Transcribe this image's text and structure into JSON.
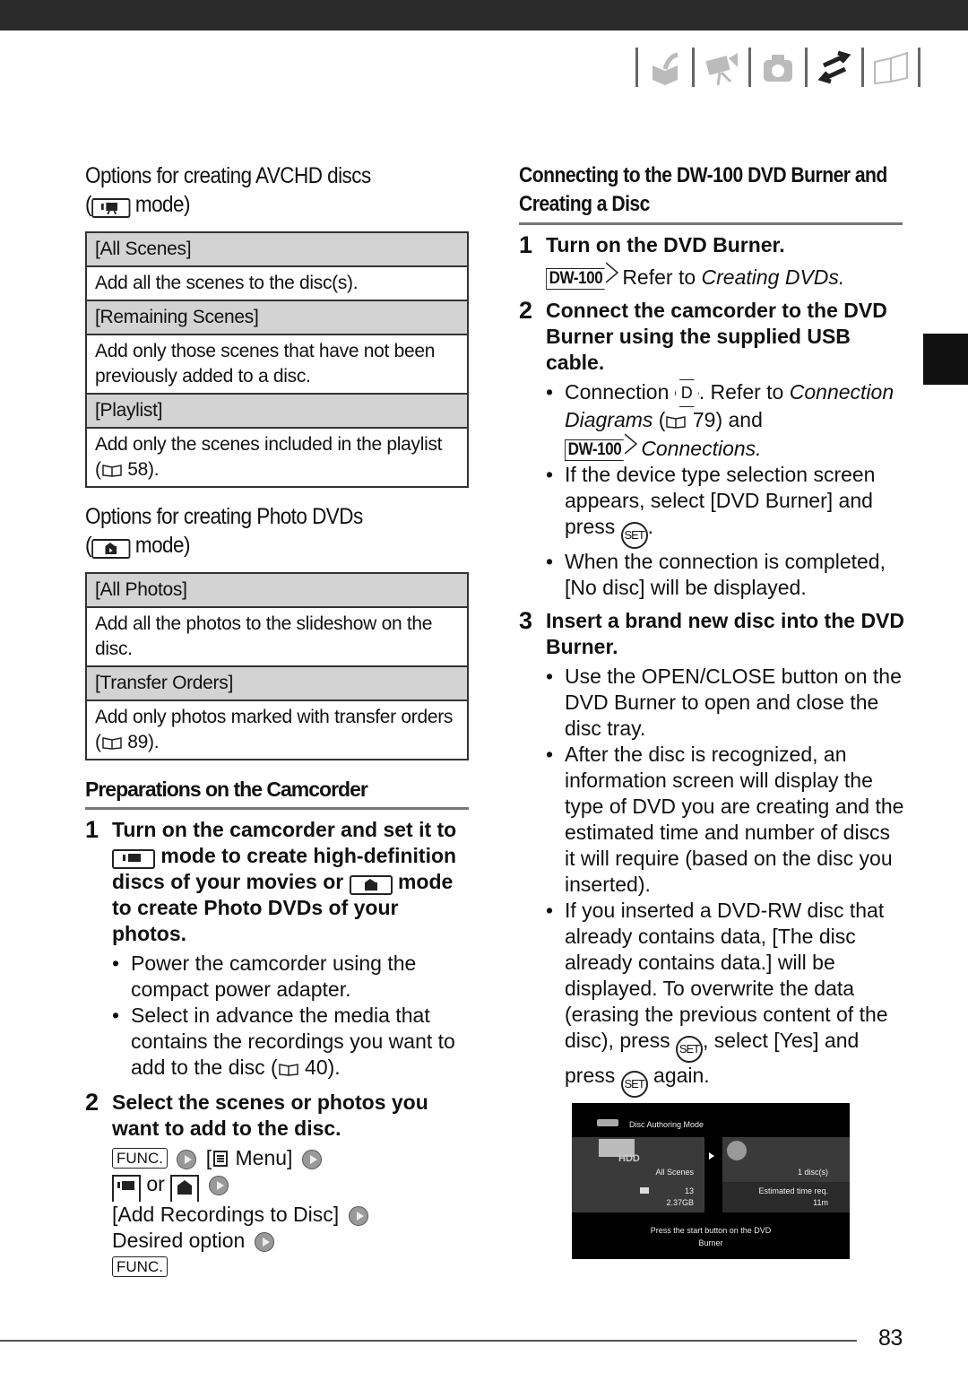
{
  "nav_icons": [
    "prepare-icon",
    "movie-icon",
    "photo-icon",
    "external-connections-icon",
    "additional-info-icon"
  ],
  "left": {
    "avchd_title_1": "Options for creating AVCHD discs",
    "avchd_title_2": "mode)",
    "avchd_rows": [
      {
        "option": "[All Scenes]",
        "desc": "Add all the scenes to the disc(s)."
      },
      {
        "option": "[Remaining Scenes]",
        "desc": "Add only those scenes that have not been previously added to a disc."
      },
      {
        "option": "[Playlist]",
        "desc": "Add only the scenes included in the playlist",
        "ref": "58)."
      }
    ],
    "photo_title_1": "Options for creating Photo DVDs",
    "photo_title_2": "mode)",
    "photo_rows": [
      {
        "option": "[All Photos]",
        "desc": "Add all the photos to the slideshow on the disc."
      },
      {
        "option": "[Transfer Orders]",
        "desc": "Add only photos marked with transfer orders",
        "ref": "89)."
      }
    ],
    "prep_title": "Preparations on the Camcorder",
    "step1": {
      "num": "1",
      "a": "Turn on the camcorder and set it to",
      "b": "mode to create high-definition discs of your movies or",
      "c": "mode to create Photo DVDs of your photos."
    },
    "step1_bullets": [
      "Power the camcorder using the compact power adapter.",
      "Select in advance the media that contains the recordings you want to add to the disc ("
    ],
    "step1_ref": "40).",
    "step2": {
      "num": "2",
      "text": "Select the scenes or photos you want to add to the disc."
    },
    "func": "FUNC.",
    "menu": "Menu]",
    "or": "or",
    "add_rec": "[Add Recordings to Disc]",
    "desired": "Desired option"
  },
  "right": {
    "title": "Connecting to the DW-100 DVD Burner and Creating a Disc",
    "dw": "DW-100",
    "s1": {
      "num": "1",
      "text": "Turn on the DVD Burner.",
      "ref_pre": "Refer to",
      "ref_it": "Creating DVDs."
    },
    "s2": {
      "num": "2",
      "text": "Connect the camcorder to the DVD Burner using the supplied USB cable."
    },
    "conn": {
      "a": "Connection",
      "d": "D",
      "b": ". Refer to",
      "it": "Connection Diagrams",
      "c": "79) and",
      "it2": "Connections."
    },
    "b2a": "If the device type selection screen appears, select [DVD Burner] and press",
    "set": "SET",
    "b3": "When the connection is completed, [No disc] will be displayed.",
    "s3": {
      "num": "3",
      "text": "Insert a brand new disc into the DVD Burner."
    },
    "b4": "Use the OPEN/CLOSE button on the DVD Burner to open and close the disc tray.",
    "b5": "After the disc is recognized, an information screen will display the type of DVD you are creating and the estimated time and number of discs it will require (based on the disc you inserted).",
    "b6a": "If you inserted a DVD-RW disc that already contains data, [The disc already contains data.] will be displayed. To overwrite the data (erasing the previous content of the disc), press",
    "b6b": ", select [Yes] and press",
    "b6c": "again."
  },
  "screen": {
    "title": "Disc Authoring Mode",
    "hdd": "HDD",
    "scenes": "All Scenes",
    "count": "13",
    "size": "2.37GB",
    "discs": "1 disc(s)",
    "est": "Estimated time req.",
    "time": "11m",
    "msg1": "Press the start button on the DVD",
    "msg2": "Burner"
  },
  "page_number": "83"
}
